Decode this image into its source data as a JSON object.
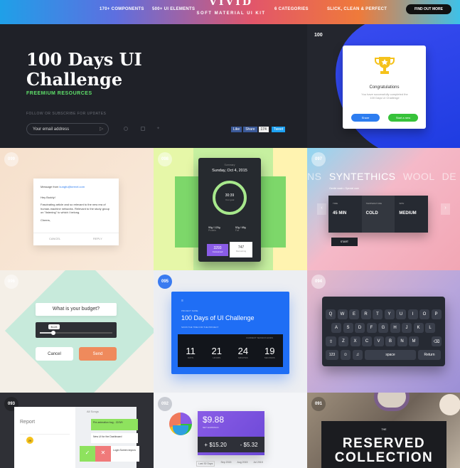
{
  "header": {
    "nav_components": "170+ COMPONENTS",
    "nav_elements": "500+ UI ELEMENTS",
    "brand_title": "VIVID",
    "brand_subtitle": "SOFT MATERIAL UI KIT",
    "nav_categories": "6 CATEGORIES",
    "nav_style": "SLICK, CLEAN & PERFECT",
    "cta": "FIND OUT MORE"
  },
  "hero": {
    "title_line1": "100 Days UI",
    "title_line2": "Challenge",
    "subtitle": "FREEMIUM RESOURCES",
    "follow": "FOLLOW OR SUBSCRIBE FOR UPDATES",
    "email_placeholder": "Your email address",
    "social": {
      "like": "Like",
      "share": "Share",
      "count": "174",
      "tweet": "Tweet"
    }
  },
  "tiles": {
    "t100": {
      "num": "100",
      "title": "Congratulations",
      "body": "You have successfully completed the 100 Days UI Challenge",
      "share": "Share",
      "start": "Start a new"
    },
    "t099": {
      "num": "099",
      "from_label": "Message from",
      "from": "kungfu@kernel.com",
      "greeting": "Hey Buddy!",
      "body": "Fascinating article and so relevant to the new era of human-machine networks. Relevant to the study group on \"listening\" to which I belong.",
      "sign": "Cheers,",
      "cancel": "CANCEL",
      "reply": "REPLY"
    },
    "t098": {
      "num": "098",
      "label": "Summary",
      "date": "Sunday, Oct 4, 2015",
      "ring_value": "30:39",
      "ring_label": "Your goal",
      "stat_a": "90g / 120g",
      "stat_a_label": "Protein",
      "stat_b": "52g / 65g",
      "stat_b_label": "Fat",
      "kcal_a": "3293",
      "kcal_a_label": "Consumed",
      "kcal_b": "747",
      "kcal_b_label": "Remaining"
    },
    "t097": {
      "num": "097",
      "w1": "NS",
      "w2": "SYNTETHICS",
      "w3": "WOOL",
      "w4": "DE",
      "info": "Gentle wash  •  Special care",
      "c1_label": "TIME",
      "c1_value": "45 MIN",
      "c2_label": "TEMPERATURE",
      "c2_value": "COLD",
      "c3_label": "SPIN",
      "c3_value": "MEDIUM",
      "start": "START"
    },
    "t096": {
      "num": "096",
      "question": "What is your budget?",
      "slider_value": "$128",
      "cancel": "Cancel",
      "send": "Send"
    },
    "t095": {
      "num": "095",
      "label": "PROJECT NAME",
      "title": "100 Days of UI Challenge",
      "sub": "SOON THE TIME FOR THE PROJECT",
      "ends": "CURRENT SESSION ENDS",
      "d": "11",
      "d_l": "DAYS",
      "h": "21",
      "h_l": "HOURS",
      "m": "24",
      "m_l": "MINUTES",
      "s": "19",
      "s_l": "SECONDS"
    },
    "t094": {
      "num": "094",
      "row1": [
        "Q",
        "W",
        "E",
        "R",
        "T",
        "Y",
        "U",
        "I",
        "O",
        "P"
      ],
      "row2": [
        "A",
        "S",
        "D",
        "F",
        "G",
        "H",
        "J",
        "K",
        "L"
      ],
      "row3": [
        "Z",
        "X",
        "C",
        "V",
        "B",
        "N",
        "M"
      ],
      "k123": "123",
      "space": "space",
      "return": "Return"
    },
    "t093": {
      "num": "093",
      "title": "Report",
      "all": "All Songs",
      "day": "29",
      "items": [
        "Pre-animation bug - 22/3/9",
        "New UI for the Dashboard",
        "Login Screen improv"
      ]
    },
    "t092": {
      "num": "092",
      "amount": "$9.88",
      "amount_label": "NET EARNINGS",
      "plus": "+ $15.20",
      "minus": "- $5.32",
      "tabs": [
        "Last 30 Days",
        "Sep 2015",
        "Aug 2015",
        "Jul 2015"
      ]
    },
    "t091": {
      "num": "091",
      "the": "THE",
      "line1": "RESERVED",
      "line2": "COLLECTION"
    }
  },
  "colors": {
    "green": "#37c23a",
    "blue": "#2d7df0",
    "orange": "#ef8a5c",
    "purple": "#8a5ce6"
  }
}
